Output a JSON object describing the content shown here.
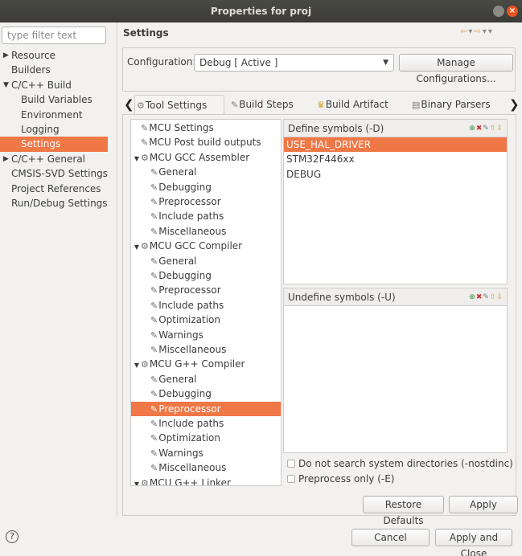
{
  "window": {
    "title": "Properties for proj",
    "close_glyph": "×"
  },
  "filter": {
    "placeholder": "type filter text"
  },
  "nav": {
    "items": [
      {
        "label": "Resource",
        "arrow": "▶",
        "level": 0
      },
      {
        "label": "Builders",
        "arrow": "",
        "level": 0
      },
      {
        "label": "C/C++ Build",
        "arrow": "▼",
        "level": 0
      },
      {
        "label": "Build Variables",
        "arrow": "",
        "level": 1
      },
      {
        "label": "Environment",
        "arrow": "",
        "level": 1
      },
      {
        "label": "Logging",
        "arrow": "",
        "level": 1
      },
      {
        "label": "Settings",
        "arrow": "",
        "level": 1,
        "selected": true
      },
      {
        "label": "C/C++ General",
        "arrow": "▶",
        "level": 0
      },
      {
        "label": "CMSIS-SVD Settings",
        "arrow": "",
        "level": 0
      },
      {
        "label": "Project References",
        "arrow": "",
        "level": 0
      },
      {
        "label": "Run/Debug Settings",
        "arrow": "",
        "level": 0
      }
    ]
  },
  "header": {
    "title": "Settings",
    "nav_glyphs": {
      "back": "⇦",
      "back_menu": "▾",
      "fwd": "⇨",
      "fwd_menu": "▾",
      "menu": "▾"
    }
  },
  "config": {
    "label": "Configuration:",
    "value": "Debug  [ Active ]",
    "caret": "▼",
    "manage_button": "Manage Configurations..."
  },
  "tabs": {
    "left_arrow": "❮",
    "right_arrow": "❯",
    "items": [
      {
        "label": "Tool Settings",
        "icon": "⚙",
        "active": true
      },
      {
        "label": "Build Steps",
        "icon": "✎"
      },
      {
        "label": "Build Artifact",
        "icon": "♛"
      },
      {
        "label": "Binary Parsers",
        "icon": "▤"
      }
    ]
  },
  "tree": {
    "items": [
      {
        "label": "MCU Settings",
        "arrow": "",
        "level": 0,
        "icon": "✎"
      },
      {
        "label": "MCU Post build outputs",
        "arrow": "",
        "level": 0,
        "icon": "✎"
      },
      {
        "label": "MCU GCC Assembler",
        "arrow": "▼",
        "level": 0,
        "icon": "⚙"
      },
      {
        "label": "General",
        "arrow": "",
        "level": 1,
        "icon": "✎"
      },
      {
        "label": "Debugging",
        "arrow": "",
        "level": 1,
        "icon": "✎"
      },
      {
        "label": "Preprocessor",
        "arrow": "",
        "level": 1,
        "icon": "✎"
      },
      {
        "label": "Include paths",
        "arrow": "",
        "level": 1,
        "icon": "✎"
      },
      {
        "label": "Miscellaneous",
        "arrow": "",
        "level": 1,
        "icon": "✎"
      },
      {
        "label": "MCU GCC Compiler",
        "arrow": "▼",
        "level": 0,
        "icon": "⚙"
      },
      {
        "label": "General",
        "arrow": "",
        "level": 1,
        "icon": "✎"
      },
      {
        "label": "Debugging",
        "arrow": "",
        "level": 1,
        "icon": "✎"
      },
      {
        "label": "Preprocessor",
        "arrow": "",
        "level": 1,
        "icon": "✎"
      },
      {
        "label": "Include paths",
        "arrow": "",
        "level": 1,
        "icon": "✎"
      },
      {
        "label": "Optimization",
        "arrow": "",
        "level": 1,
        "icon": "✎"
      },
      {
        "label": "Warnings",
        "arrow": "",
        "level": 1,
        "icon": "✎"
      },
      {
        "label": "Miscellaneous",
        "arrow": "",
        "level": 1,
        "icon": "✎"
      },
      {
        "label": "MCU G++ Compiler",
        "arrow": "▼",
        "level": 0,
        "icon": "⚙"
      },
      {
        "label": "General",
        "arrow": "",
        "level": 1,
        "icon": "✎"
      },
      {
        "label": "Debugging",
        "arrow": "",
        "level": 1,
        "icon": "✎"
      },
      {
        "label": "Preprocessor",
        "arrow": "",
        "level": 1,
        "icon": "✎",
        "selected": true
      },
      {
        "label": "Include paths",
        "arrow": "",
        "level": 1,
        "icon": "✎"
      },
      {
        "label": "Optimization",
        "arrow": "",
        "level": 1,
        "icon": "✎"
      },
      {
        "label": "Warnings",
        "arrow": "",
        "level": 1,
        "icon": "✎"
      },
      {
        "label": "Miscellaneous",
        "arrow": "",
        "level": 1,
        "icon": "✎"
      },
      {
        "label": "MCU G++ Linker",
        "arrow": "▼",
        "level": 0,
        "icon": "⚙"
      }
    ]
  },
  "define_panel": {
    "title": "Define symbols (-D)",
    "symbols": [
      {
        "label": "USE_HAL_DRIVER",
        "selected": true
      },
      {
        "label": "STM32F446xx"
      },
      {
        "label": "DEBUG"
      }
    ]
  },
  "undefine_panel": {
    "title": "Undefine symbols (-U)",
    "symbols": []
  },
  "tool_glyphs": {
    "add": "⊕",
    "delete": "✖",
    "edit": "✎",
    "up": "⇧",
    "down": "⇩"
  },
  "options": {
    "nostdinc": {
      "label": "Do not search system directories (-nostdinc)",
      "checked": false
    },
    "preprocess_only": {
      "label": "Preprocess only (-E)",
      "checked": false
    }
  },
  "buttons": {
    "restore_defaults": "Restore Defaults",
    "apply": "Apply",
    "cancel": "Cancel",
    "apply_close": "Apply and Close",
    "help": "?"
  },
  "colors": {
    "selection": "#f07746",
    "titlebar": "#3c3b37",
    "close": "#e95420"
  }
}
